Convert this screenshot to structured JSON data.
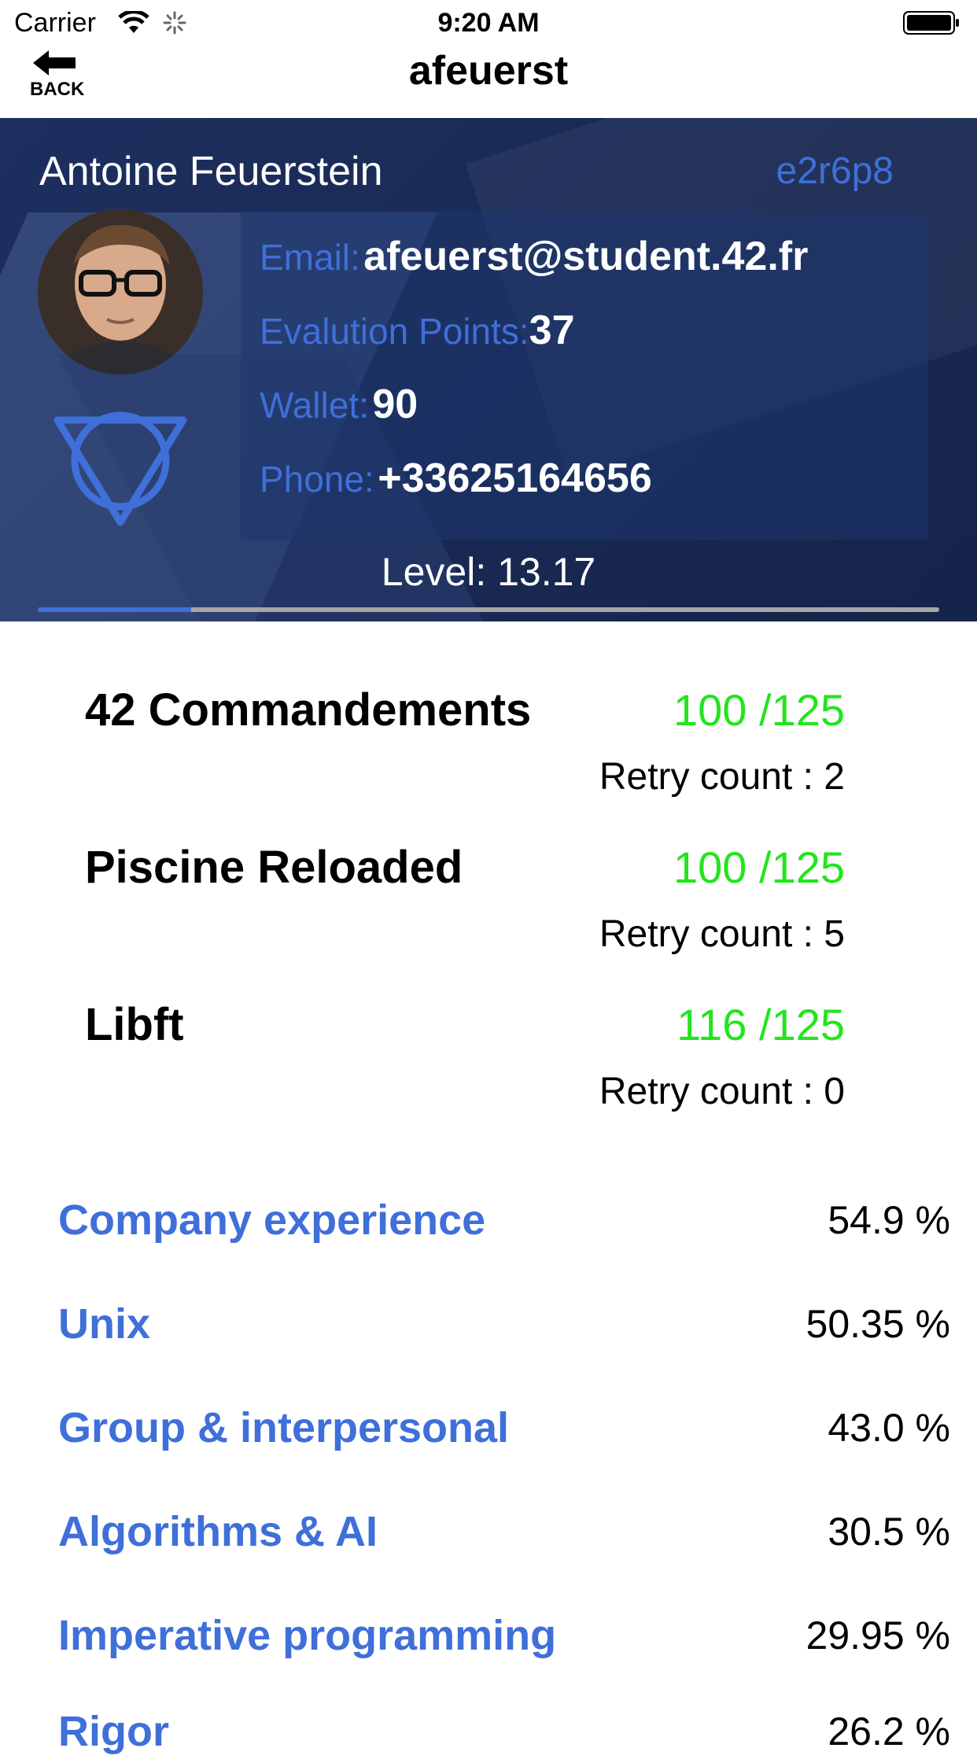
{
  "status_bar": {
    "carrier": "Carrier",
    "time": "9:20 AM"
  },
  "nav": {
    "back_label": "BACK",
    "title": "afeuerst"
  },
  "profile": {
    "display_name": "Antoine Feuerstein",
    "location": "e2r6p8",
    "email_label": "Email:",
    "email": "afeuerst@student.42.fr",
    "eval_label": "Evalution Points:",
    "eval_points": "37",
    "wallet_label": "Wallet:",
    "wallet": "90",
    "phone_label": "Phone:",
    "phone": "+33625164656",
    "level_text": "Level: 13.17",
    "level_progress": 0.17
  },
  "projects": [
    {
      "name": "42 Commandements",
      "score": "100 /125",
      "retry": "Retry count : 2"
    },
    {
      "name": "Piscine Reloaded",
      "score": "100 /125",
      "retry": "Retry count : 5"
    },
    {
      "name": "Libft",
      "score": "116 /125",
      "retry": "Retry count : 0"
    }
  ],
  "skills": [
    {
      "name": "Company experience",
      "percent": "54.9 %"
    },
    {
      "name": "Unix",
      "percent": "50.35 %"
    },
    {
      "name": "Group & interpersonal",
      "percent": "43.0 %"
    },
    {
      "name": "Algorithms & AI",
      "percent": "30.5 %"
    },
    {
      "name": "Imperative programming",
      "percent": "29.95 %"
    },
    {
      "name": "Rigor",
      "percent": "26.2 %"
    }
  ],
  "colors": {
    "accent": "#3f6fd9",
    "score_green": "#22e51d",
    "header_bg": "#1a2a55"
  }
}
